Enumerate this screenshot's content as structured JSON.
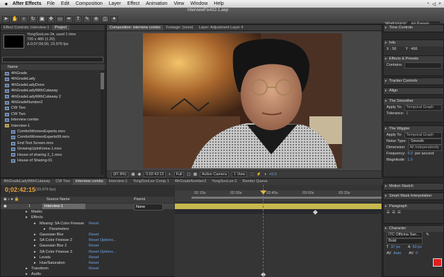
{
  "menubar": {
    "app": "After Effects",
    "items": [
      "File",
      "Edit",
      "Composition",
      "Layer",
      "Effect",
      "Animation",
      "View",
      "Window",
      "Help"
    ]
  },
  "toolbar": {
    "window_title": "InterviewFix422-1.aep",
    "workspace_label": "Workspace:",
    "workspace_value": "All Panels"
  },
  "project": {
    "tabs": [
      "Effect Controls: Interview-1",
      "Project"
    ],
    "selected_name": "YongSooLee-2▾, used 1 time",
    "selected_size": "720 x 480 (1.20)",
    "selected_duration": "Δ 0;07;06;00, 23.976 fps",
    "column_name": "Name",
    "items": [
      {
        "label": "4thGrade",
        "type": "comp"
      },
      {
        "label": "4thGradeLady",
        "type": "comp"
      },
      {
        "label": "4thGradeLadyDone",
        "type": "comp"
      },
      {
        "label": "4thGradeLadyWithCutaway",
        "type": "comp"
      },
      {
        "label": "4thGradeLadyWithCutaway 2",
        "type": "comp"
      },
      {
        "label": "4thGradeNumber2",
        "type": "comp"
      },
      {
        "label": "CW Two",
        "type": "comp"
      },
      {
        "label": "CW Two",
        "type": "comp"
      },
      {
        "label": "interview combo",
        "type": "comp"
      },
      {
        "label": "Interview-1",
        "type": "folder"
      },
      {
        "label": "ComfortWomenExperts.mov",
        "type": "sub"
      },
      {
        "label": "ComfortWomenExperts99.mov",
        "type": "sub"
      },
      {
        "label": "End Text Screen.mov",
        "type": "sub"
      },
      {
        "label": "GrowingUpInKorea-1.mov",
        "type": "sub"
      },
      {
        "label": "House of sharing 2_1.mov",
        "type": "sub"
      },
      {
        "label": "House of Sharing-01",
        "type": "sub"
      }
    ]
  },
  "comp": {
    "tabs": [
      "Composition: interview combo",
      "Footage: (none)",
      "Layer: Adjustment Layer 4"
    ],
    "zoom": "(87.9%)",
    "timecode": "0;02:42:15",
    "resolution": "Full",
    "camera": "Active Camera",
    "view": "1 View",
    "exposure": "+0.0"
  },
  "right_panels": {
    "time_controls": "Time Controls",
    "info": "Info",
    "info_x": "X : 56",
    "info_y": "Y : 466",
    "effects_presets": "Effects & Presets",
    "contains_label": "Contains:",
    "tracker": "Tracker Controls",
    "align": "Align",
    "smoother": "The Smoother",
    "apply_to": "Apply To:",
    "apply_to_value": "Temporal Graph",
    "tolerance": "Tolerance:",
    "tolerance_value": "1",
    "wiggler": "The Wiggler",
    "wig_apply_value": "Temporal Graph",
    "noise_type": "Noise Type:",
    "noise_type_value": "Smooth",
    "dimension": "Dimension:",
    "dimension_value": "All Independently",
    "frequency": "Frequency:",
    "frequency_value": "5.0",
    "frequency_unit": "per second",
    "magnitude": "Magnitude:",
    "magnitude_value": "1.0",
    "motion_sketch": "Motion Sketch",
    "smart_mask": "Smart Mask Interpolation",
    "paragraph": "Paragraph",
    "character": "Character",
    "font": "ITC Officina San...",
    "font_style": "Bold",
    "font_size": "37 px",
    "leading": "50 px",
    "tracking": "Auto",
    "kerning": "0",
    "accent_color": "#e02020"
  },
  "timeline": {
    "tabs": [
      "4thGradeLadyWithCutaway",
      "CW Two",
      "interview combo",
      "Interview-1",
      "YongSooLee Comp 1",
      "4thGradeNumber2",
      "YongSooLee-2",
      "Render Queue"
    ],
    "current_time": "0;02:42:15",
    "fps": "(23.976 fps)",
    "col_source": "Source Name",
    "col_parent": "Parent",
    "layer_num": "1",
    "layer_name": "Interview-1",
    "parent_value": "None",
    "ruler": [
      "02:15s",
      "02:30s",
      "02:45s",
      "03:00s",
      "03:15s"
    ],
    "rows": [
      {
        "label": "Masks",
        "indent": 44
      },
      {
        "label": "Effects",
        "indent": 44
      },
      {
        "label": "Missing: SA Color Finesse",
        "indent": 56,
        "link": "Reset"
      },
      {
        "label": "Parameters",
        "indent": 70
      },
      {
        "label": "Gaussian Blur",
        "indent": 56,
        "link": "Reset"
      },
      {
        "label": "SA Color Finesse 2",
        "indent": 56,
        "link": "Reset",
        "opt": "Options..."
      },
      {
        "label": "Gaussian Blur 2",
        "indent": 56,
        "link": "Reset"
      },
      {
        "label": "SA Color Finesse 3",
        "indent": 56,
        "link": "Reset",
        "opt": "Options..."
      },
      {
        "label": "Levels",
        "indent": 56,
        "link": "Reset"
      },
      {
        "label": "Hue/Saturation",
        "indent": 56,
        "link": "Reset"
      },
      {
        "label": "Transform",
        "indent": 44,
        "link": "Reset"
      },
      {
        "label": "Audio",
        "indent": 44
      }
    ]
  }
}
